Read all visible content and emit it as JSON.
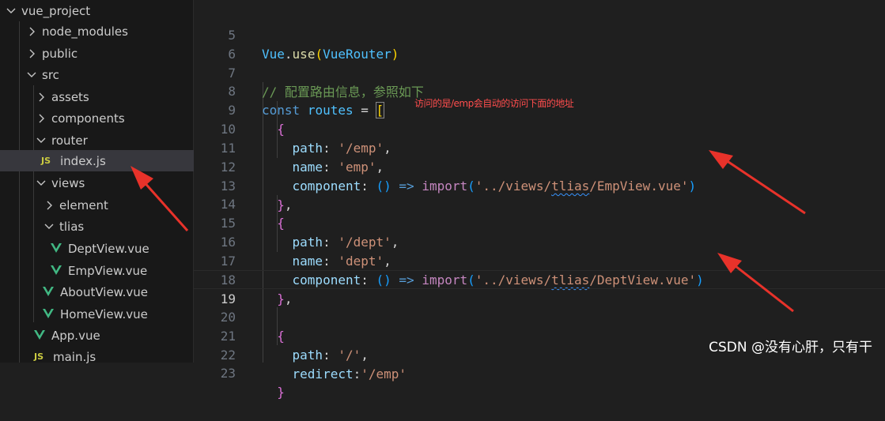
{
  "explorer": {
    "items": [
      {
        "label": "vue_project",
        "kind": "folder-open"
      },
      {
        "label": "node_modules",
        "kind": "folder"
      },
      {
        "label": "public",
        "kind": "folder"
      },
      {
        "label": "src",
        "kind": "folder-open"
      },
      {
        "label": "assets",
        "kind": "folder"
      },
      {
        "label": "components",
        "kind": "folder"
      },
      {
        "label": "router",
        "kind": "folder-open"
      },
      {
        "label": "index.js",
        "kind": "js",
        "selected": true
      },
      {
        "label": "views",
        "kind": "folder-open"
      },
      {
        "label": "element",
        "kind": "folder"
      },
      {
        "label": "tlias",
        "kind": "folder-open"
      },
      {
        "label": "DeptView.vue",
        "kind": "vue"
      },
      {
        "label": "EmpView.vue",
        "kind": "vue"
      },
      {
        "label": "AboutView.vue",
        "kind": "vue"
      },
      {
        "label": "HomeView.vue",
        "kind": "vue"
      },
      {
        "label": "App.vue",
        "kind": "vue"
      },
      {
        "label": "main.js",
        "kind": "js"
      }
    ],
    "js_badge": "JS",
    "vue_color": "#41b883"
  },
  "editor": {
    "current_line": "19",
    "lines": [
      {
        "n": "5"
      },
      {
        "n": "6"
      },
      {
        "n": "7"
      },
      {
        "n": "8"
      },
      {
        "n": "9"
      },
      {
        "n": "10"
      },
      {
        "n": "11"
      },
      {
        "n": "12"
      },
      {
        "n": "13"
      },
      {
        "n": "14"
      },
      {
        "n": "15"
      },
      {
        "n": "16"
      },
      {
        "n": "17"
      },
      {
        "n": "18"
      },
      {
        "n": "19"
      },
      {
        "n": "20"
      },
      {
        "n": "21"
      },
      {
        "n": "22"
      },
      {
        "n": "23"
      }
    ],
    "tokens": {
      "vue": "Vue",
      "use": "use",
      "vuerouter": "VueRouter",
      "comment": "// 配置路由信息，参照如下",
      "const": "const",
      "routes": "routes",
      "path": "path",
      "name": "name",
      "component": "component",
      "redirect": "redirect",
      "import": "import",
      "emp_path": "'/emp'",
      "emp_name": "'emp'",
      "emp_import_a": "'../views/",
      "tlias": "tlias",
      "emp_import_b": "/EmpView.vue'",
      "dept_path": "'/dept'",
      "dept_name": "'dept'",
      "dept_import_b": "/DeptView.vue'",
      "root_path": "'/'",
      "redirect_val": "'/emp'"
    }
  },
  "annotation": "访问的是/emp会自动的访问下面的地址",
  "watermark": "CSDN @没有心肝，只有干",
  "colors": {
    "annotation": "#ff4d4d",
    "arrow": "#e8322a"
  }
}
